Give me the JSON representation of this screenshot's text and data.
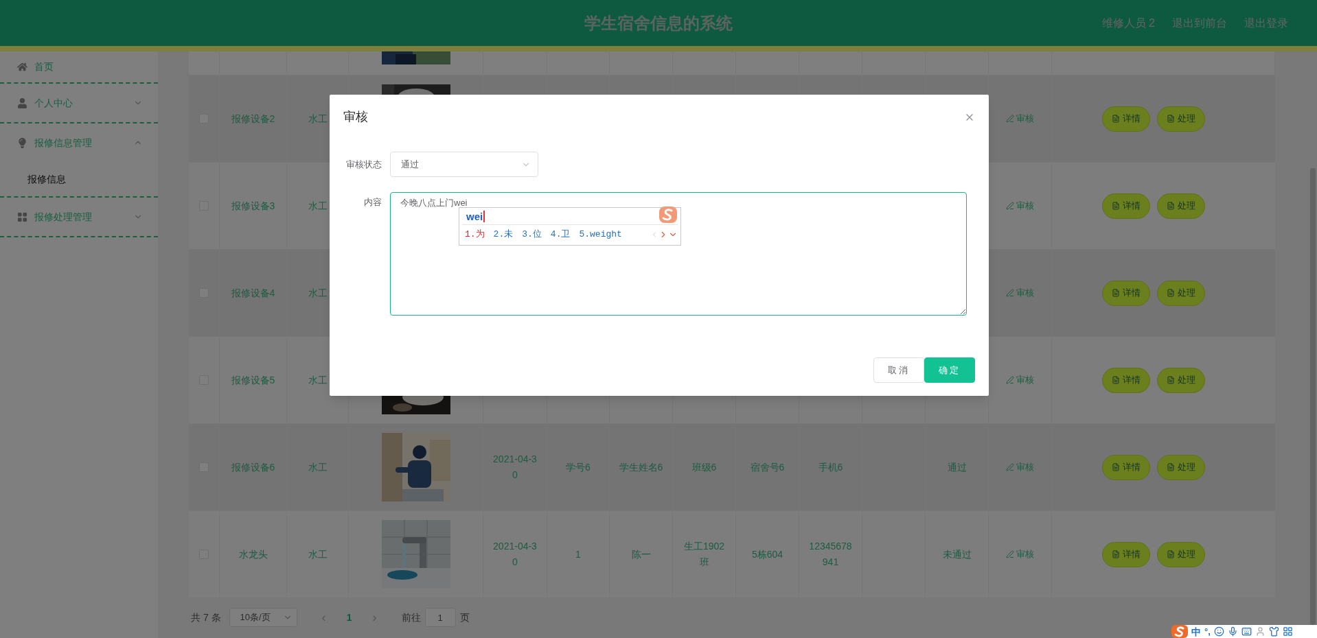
{
  "header": {
    "title": "学生宿舍信息的系统",
    "user": "维修人员 2",
    "links": [
      "退出到前台",
      "退出登录"
    ]
  },
  "sidebar": {
    "items": [
      {
        "label": "首页"
      },
      {
        "label": "个人中心",
        "expanded": false
      },
      {
        "label": "报修信息管理",
        "expanded": true,
        "children": [
          {
            "label": "报修信息"
          }
        ]
      },
      {
        "label": "报修处理管理",
        "expanded": false
      }
    ]
  },
  "table": {
    "rows": [
      {
        "kind": "cut"
      },
      {
        "kind": "full",
        "checked": false,
        "name": "报修设备2",
        "type": "水工",
        "audit": "审核",
        "buttons": [
          "详情",
          "处理"
        ]
      },
      {
        "kind": "full",
        "checked": false,
        "name": "报修设备3",
        "type": "水工",
        "audit": "审核",
        "buttons": [
          "详情",
          "处理"
        ]
      },
      {
        "kind": "full",
        "checked": false,
        "name": "报修设备4",
        "type": "水工",
        "audit": "审核",
        "buttons": [
          "详情",
          "处理"
        ]
      },
      {
        "kind": "full",
        "checked": false,
        "name": "报修设备5",
        "type": "水工",
        "audit": "审核",
        "buttons": [
          "详情",
          "处理"
        ]
      },
      {
        "kind": "full",
        "checked": false,
        "name": "报修设备6",
        "type": "水工",
        "date": "2021-04-30",
        "student_no": "学号6",
        "student_name": "学生姓名6",
        "class": "班级6",
        "dorm": "宿舍号6",
        "phone": "手机6",
        "status": "通过",
        "audit": "审核",
        "buttons": [
          "详情",
          "处理"
        ]
      },
      {
        "kind": "full",
        "checked": false,
        "name": "水龙头",
        "type": "水工",
        "date": "2021-04-30",
        "student_no": "1",
        "student_name": "陈一",
        "class": "生工1902班",
        "dorm": "5栋604",
        "phone": "12345678941",
        "status": "未通过",
        "audit": "审核",
        "buttons": [
          "详情",
          "处理"
        ]
      }
    ]
  },
  "pagination": {
    "total": "共 7 条",
    "page_size": "10条/页",
    "prev": "‹",
    "pages": [
      {
        "label": "1",
        "selected": true
      }
    ],
    "next": "›",
    "goto_label": "前往",
    "goto_value": "1",
    "goto_suffix": "页"
  },
  "dialog": {
    "title": "审核",
    "fields": [
      {
        "label": "审核状态",
        "kind": "select",
        "value": "通过"
      },
      {
        "label": "内容",
        "kind": "textarea",
        "value": "今晚八点上门wei"
      }
    ],
    "ime": {
      "composition": "wei",
      "candidates": [
        {
          "label": "1.为",
          "selected": true
        },
        {
          "label": "2.未",
          "selected": false
        },
        {
          "label": "3.位",
          "selected": false
        },
        {
          "label": "4.卫",
          "selected": false
        },
        {
          "label": "5.weight",
          "selected": false
        }
      ]
    },
    "buttons": [
      {
        "label": "取消",
        "kind": "secondary"
      },
      {
        "label": "确定",
        "kind": "primary"
      }
    ]
  },
  "ime_toolbar": {
    "mode": "中",
    "punct": "°,"
  }
}
